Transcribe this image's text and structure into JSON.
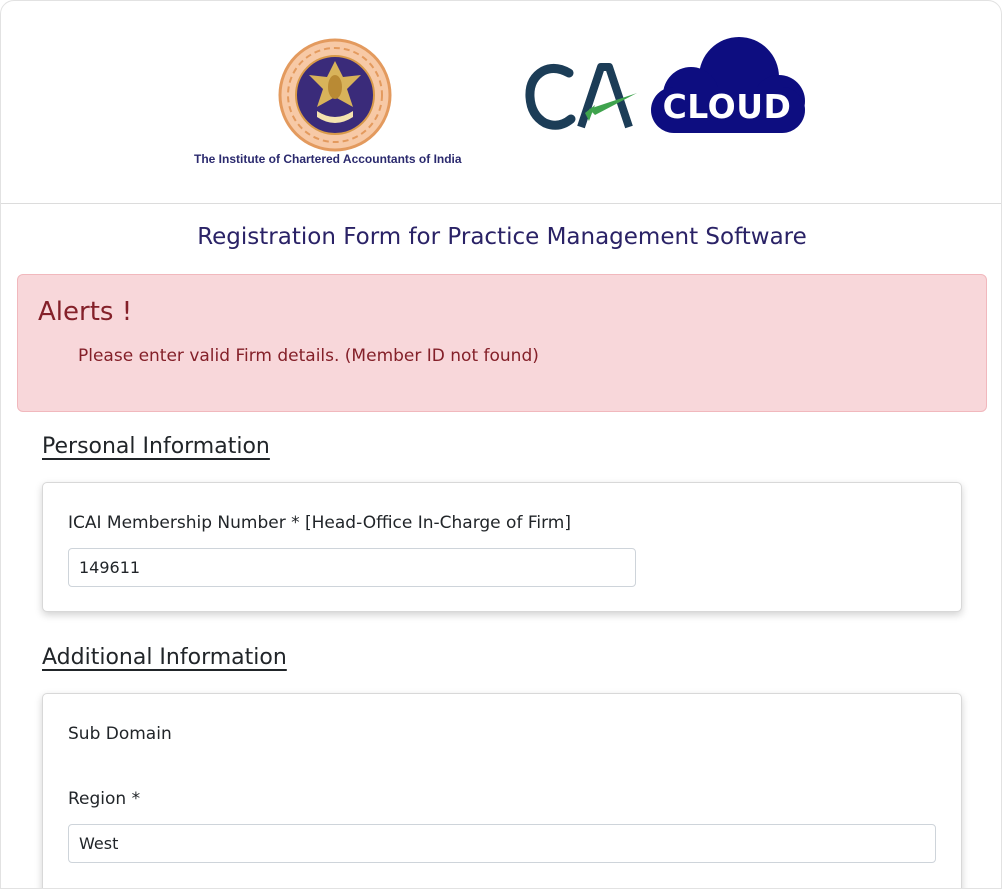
{
  "header": {
    "institute_name": "The Institute of Chartered Accountants of India",
    "ca_logo_text": "CA",
    "cloud_logo_text": "CLOUD"
  },
  "form_title": "Registration Form for Practice Management Software",
  "alert": {
    "title": "Alerts !",
    "message": "Please enter valid Firm details. (Member ID not found)"
  },
  "personal_info": {
    "title": "Personal Information",
    "membership_label": "ICAI Membership Number * [Head-Office In-Charge of Firm]",
    "membership_value": "149611"
  },
  "additional_info": {
    "title": "Additional Information",
    "subdomain_label": "Sub Domain",
    "region_label": "Region *",
    "region_value": "West"
  },
  "colors": {
    "title": "#2a2266",
    "alert_bg": "#f8d7da",
    "alert_text": "#842029",
    "cloud_blue": "#0d0d80",
    "ca_dark": "#1c3d57",
    "ca_green": "#3fa34d"
  }
}
